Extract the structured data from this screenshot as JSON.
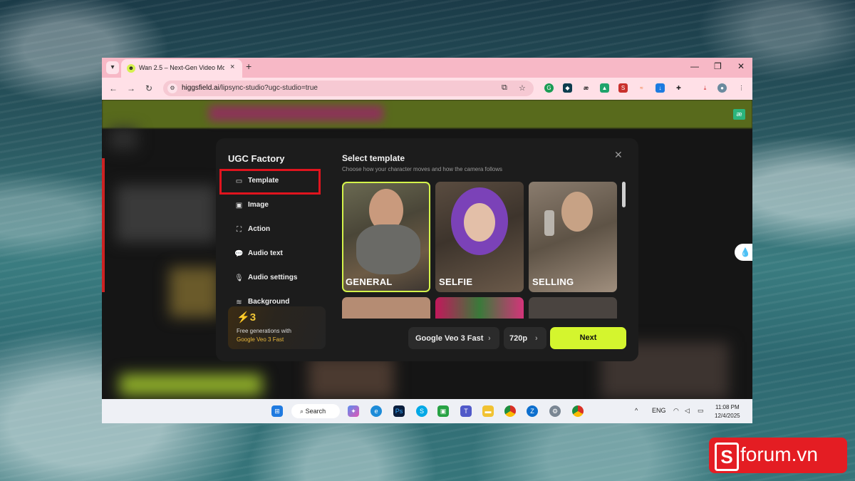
{
  "browser": {
    "tab_title": "Wan 2.5 – Next-Gen Video Mo",
    "url_host": "higgsfield.ai",
    "url_path": "/lipsync-studio?ugc-studio=true",
    "new_tab": "+",
    "close_tab": "×"
  },
  "modal": {
    "title": "UGC Factory",
    "menu": [
      {
        "label": "Template",
        "icon": "video-icon"
      },
      {
        "label": "Image",
        "icon": "image-icon"
      },
      {
        "label": "Action",
        "icon": "action-icon"
      },
      {
        "label": "Audio text",
        "icon": "chat-icon"
      },
      {
        "label": "Audio settings",
        "icon": "mic-icon"
      },
      {
        "label": "Background",
        "icon": "waveform-icon"
      }
    ],
    "promo": {
      "count": "3",
      "line1": "Free generations with",
      "line2": "Google Veo 3 Fast"
    },
    "select_title": "Select template",
    "select_subtitle": "Choose how your character moves and how the camera follows",
    "templates": [
      {
        "label": "GENERAL",
        "selected": true
      },
      {
        "label": "SELFIE",
        "selected": false
      },
      {
        "label": "SELLING",
        "selected": false
      },
      {
        "label": "",
        "selected": false
      },
      {
        "label": "",
        "selected": false
      },
      {
        "label": "",
        "selected": false
      }
    ],
    "model": "Google Veo 3 Fast",
    "resolution": "720p",
    "next": "Next"
  },
  "taskbar": {
    "search": "Search",
    "lang": "ENG",
    "time": "11:08 PM",
    "date": "12/4/2025"
  },
  "watermark": {
    "letter": "S",
    "text": "forum.vn"
  },
  "colors": {
    "accent": "#d4f52e",
    "highlight_frame": "#e0141e",
    "browser_chrome": "#f7b8c6"
  }
}
